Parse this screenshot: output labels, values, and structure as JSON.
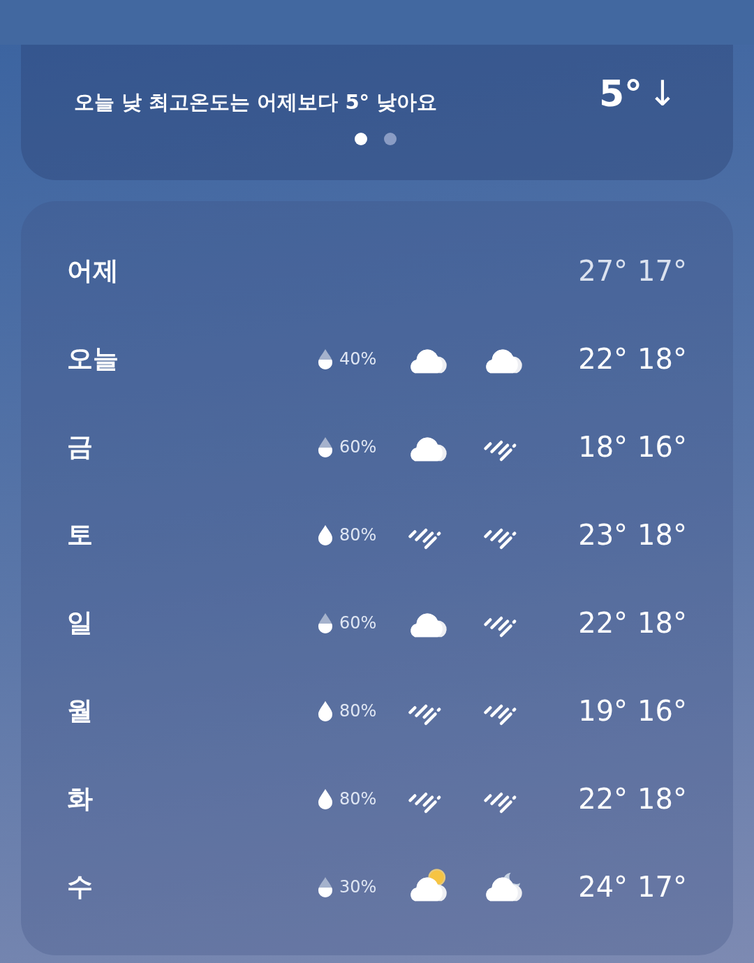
{
  "summary_card": {
    "message": "오늘 낮 최고온도는 어제보다 5° 낮아요",
    "difference": "5°",
    "arrow": "↓",
    "pager": [
      {
        "selected": true
      },
      {
        "selected": false
      }
    ]
  },
  "forecast": [
    {
      "day": "어제",
      "high": "27°",
      "low": "17°"
    },
    {
      "day": "오늘",
      "precip": {
        "kind": "half",
        "text": "40%"
      },
      "day_icon": {
        "kind": "cloudy"
      },
      "night_icon": {
        "kind": "cloudy"
      },
      "high": "22°",
      "low": "18°"
    },
    {
      "day": "금",
      "precip": {
        "kind": "half",
        "text": "60%"
      },
      "day_icon": {
        "kind": "cloudy"
      },
      "night_icon": {
        "kind": "rain"
      },
      "high": "18°",
      "low": "16°"
    },
    {
      "day": "토",
      "precip": {
        "kind": "full",
        "text": "80%"
      },
      "day_icon": {
        "kind": "rain"
      },
      "night_icon": {
        "kind": "rain"
      },
      "high": "23°",
      "low": "18°"
    },
    {
      "day": "일",
      "precip": {
        "kind": "half",
        "text": "60%"
      },
      "day_icon": {
        "kind": "cloudy"
      },
      "night_icon": {
        "kind": "rain"
      },
      "high": "22°",
      "low": "18°"
    },
    {
      "day": "월",
      "precip": {
        "kind": "full",
        "text": "80%"
      },
      "day_icon": {
        "kind": "rain"
      },
      "night_icon": {
        "kind": "rain"
      },
      "high": "19°",
      "low": "16°"
    },
    {
      "day": "화",
      "precip": {
        "kind": "full",
        "text": "80%"
      },
      "day_icon": {
        "kind": "rain"
      },
      "night_icon": {
        "kind": "rain"
      },
      "high": "22°",
      "low": "18°"
    },
    {
      "day": "수",
      "precip": {
        "kind": "half",
        "text": "30%"
      },
      "day_icon": {
        "kind": "partly-sunny"
      },
      "night_icon": {
        "kind": "partly-night"
      },
      "high": "24°",
      "low": "17°"
    }
  ]
}
